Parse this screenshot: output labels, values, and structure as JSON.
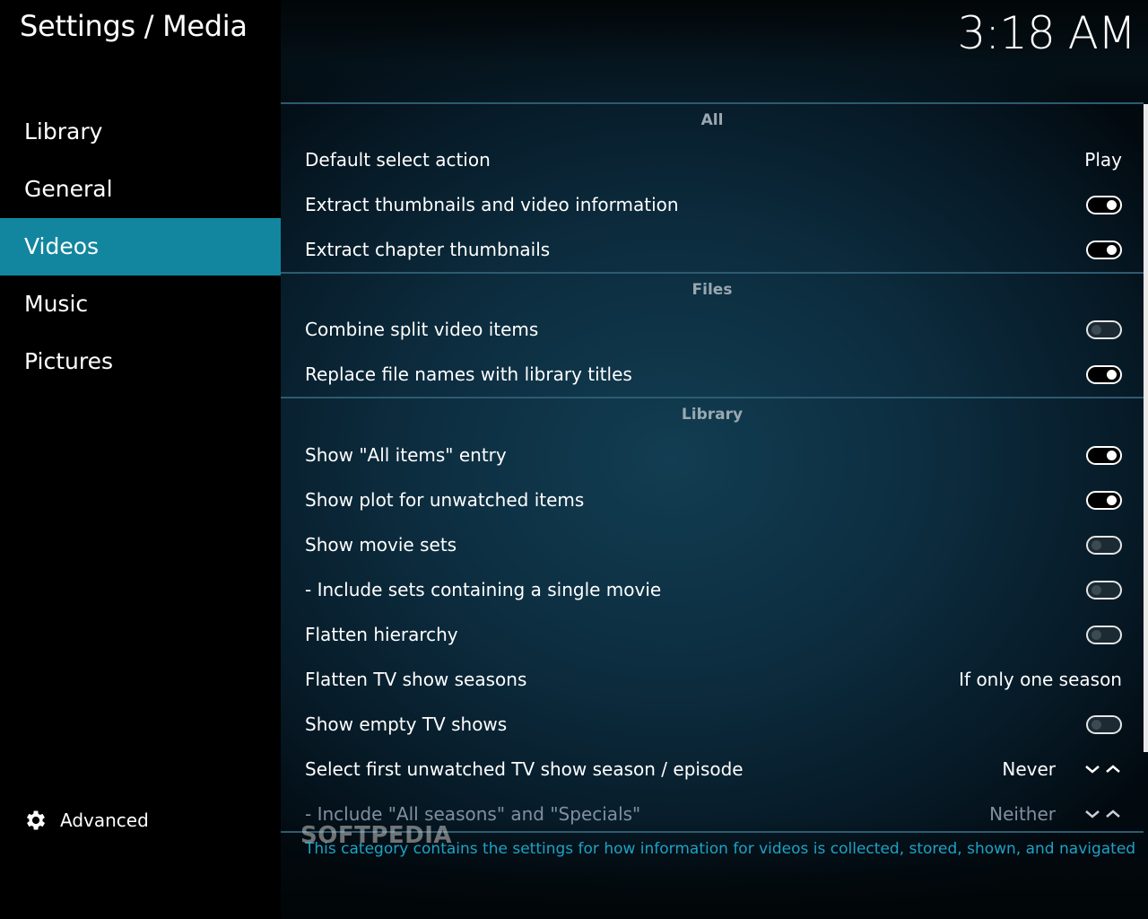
{
  "header": {
    "title": "Settings / Media",
    "clock": "3:18 AM"
  },
  "sidebar": {
    "items": [
      {
        "label": "Library"
      },
      {
        "label": "General"
      },
      {
        "label": "Videos"
      },
      {
        "label": "Music"
      },
      {
        "label": "Pictures"
      }
    ],
    "active_item": "Videos",
    "advanced_label": "Advanced"
  },
  "sections": {
    "all": {
      "header": "All",
      "default_select_action": {
        "label": "Default select action",
        "value": "Play"
      },
      "extract_thumbnails": {
        "label": "Extract thumbnails and video information",
        "state": "on"
      },
      "extract_chapter_thumbnails": {
        "label": "Extract chapter thumbnails",
        "state": "on"
      }
    },
    "files": {
      "header": "Files",
      "combine_split": {
        "label": "Combine split video items",
        "state": "off"
      },
      "replace_file_names": {
        "label": "Replace file names with library titles",
        "state": "on"
      }
    },
    "library": {
      "header": "Library",
      "show_all_items": {
        "label": "Show \"All items\" entry",
        "state": "on"
      },
      "show_plot": {
        "label": "Show plot for unwatched items",
        "state": "on"
      },
      "show_movie_sets": {
        "label": "Show movie sets",
        "state": "off"
      },
      "include_single_sets": {
        "label": "- Include sets containing a single movie",
        "state": "off"
      },
      "flatten_hierarchy": {
        "label": "Flatten hierarchy",
        "state": "off"
      },
      "flatten_tv_seasons": {
        "label": "Flatten TV show seasons",
        "value": "If only one season"
      },
      "show_empty_tv": {
        "label": "Show empty TV shows",
        "state": "off"
      },
      "select_first_unwatched": {
        "label": "Select first unwatched TV show season / episode",
        "value": "Never"
      },
      "include_all_seasons": {
        "label": "- Include \"All seasons\" and \"Specials\"",
        "value": "Neither"
      }
    }
  },
  "description": "This category contains the settings for how information for videos is collected, stored, shown, and navigated",
  "watermark": "SOFTPEDIA",
  "colors": {
    "accent": "#12869f",
    "description_text": "#1da3c6",
    "divider": "#2d5b70"
  }
}
